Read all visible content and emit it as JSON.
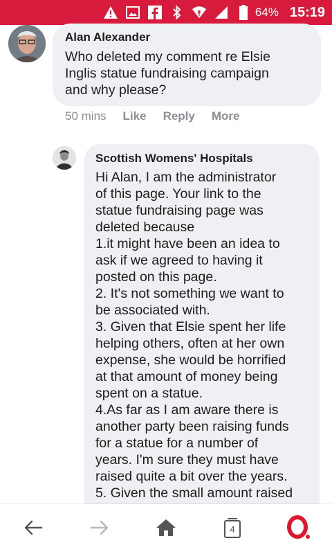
{
  "statusbar": {
    "battery": "64%",
    "time": "15:19",
    "icons": [
      "warning-icon",
      "image-icon",
      "facebook-icon",
      "bluetooth-icon",
      "wifi-icon",
      "signal-icon",
      "battery-icon"
    ]
  },
  "comments": [
    {
      "author": "Alan Alexander",
      "text": "Who deleted my comment re Elsie\nInglis statue fundraising campaign\nand why please?",
      "time": "50 mins",
      "actions": [
        "Like",
        "Reply",
        "More"
      ]
    },
    {
      "author": "Scottish Womens' Hospitals",
      "text": "Hi Alan, I am the administrator\nof this page. Your link to the\nstatue fundraising page was\ndeleted because\n1.it might have been an idea to\nask if we agreed to having it\nposted on this page.\n2. It's not something we want to\nbe associated with.\n3. Given that Elsie spent her life\nhelping others, often at her own\nexpense, she would be horrified\nat that amount of money being\nspent on a statue.\n4.As far as I am aware there is\nanother party been raising funds\nfor a statue for a number of\nyears. I'm sure they must have\nraised quite a bit over the years.\n5. Given the small amount raised"
    }
  ],
  "navbar": {
    "tabs_count": "4",
    "icons": [
      "back-arrow-icon",
      "forward-arrow-icon",
      "home-icon",
      "tabs-icon",
      "opera-logo-icon"
    ]
  }
}
